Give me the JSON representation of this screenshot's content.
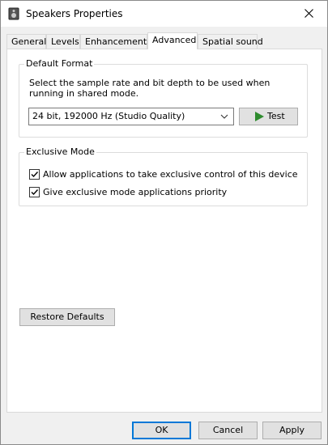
{
  "window": {
    "title": "Speakers Properties",
    "close_glyph": "✕"
  },
  "tabs": [
    {
      "label": "General"
    },
    {
      "label": "Levels"
    },
    {
      "label": "Enhancements"
    },
    {
      "label": "Advanced",
      "active": true
    },
    {
      "label": "Spatial sound"
    }
  ],
  "default_format": {
    "group_label": "Default Format",
    "description": "Select the sample rate and bit depth to be used when running in shared mode.",
    "selected_format": "24 bit, 192000 Hz (Studio Quality)",
    "test_label": "Test"
  },
  "exclusive_mode": {
    "group_label": "Exclusive Mode",
    "options": [
      {
        "label": "Allow applications to take exclusive control of this device",
        "checked": true
      },
      {
        "label": "Give exclusive mode applications priority",
        "checked": true
      }
    ]
  },
  "restore_defaults_label": "Restore Defaults",
  "footer": {
    "ok_label": "OK",
    "cancel_label": "Cancel",
    "apply_label": "Apply"
  },
  "colors": {
    "play_icon": "#2e8b2e",
    "accent": "#0078d7"
  }
}
